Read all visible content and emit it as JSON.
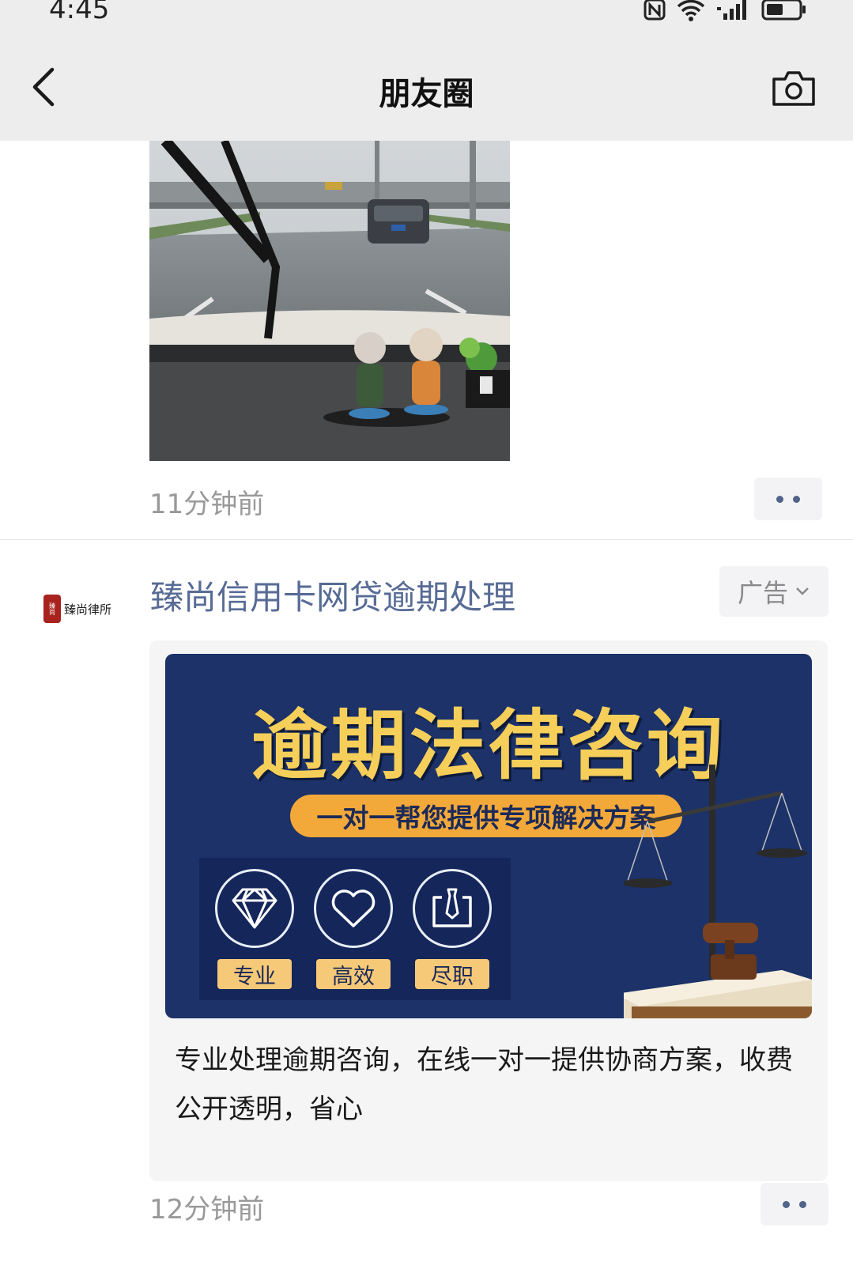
{
  "status_bar": {
    "time": "4:45"
  },
  "nav": {
    "title": "朋友圈"
  },
  "post": {
    "time": "11分钟前"
  },
  "ad": {
    "advertiser": "臻尚信用卡网贷逾期处理",
    "tag_label": "广告",
    "avatar_text": "臻尚律所",
    "banner": {
      "title": "逾期法律咨询",
      "subtitle": "一对一帮您提供专项解决方案",
      "features": [
        "专业",
        "高效",
        "尽职"
      ]
    },
    "description": "专业处理逾期咨询，在线一对一提供协商方案，收费公开透明，省心",
    "time": "12分钟前"
  },
  "colors": {
    "link": "#576b95",
    "banner_bg": "#1c3268",
    "title_gold": "#f5cf5a"
  }
}
